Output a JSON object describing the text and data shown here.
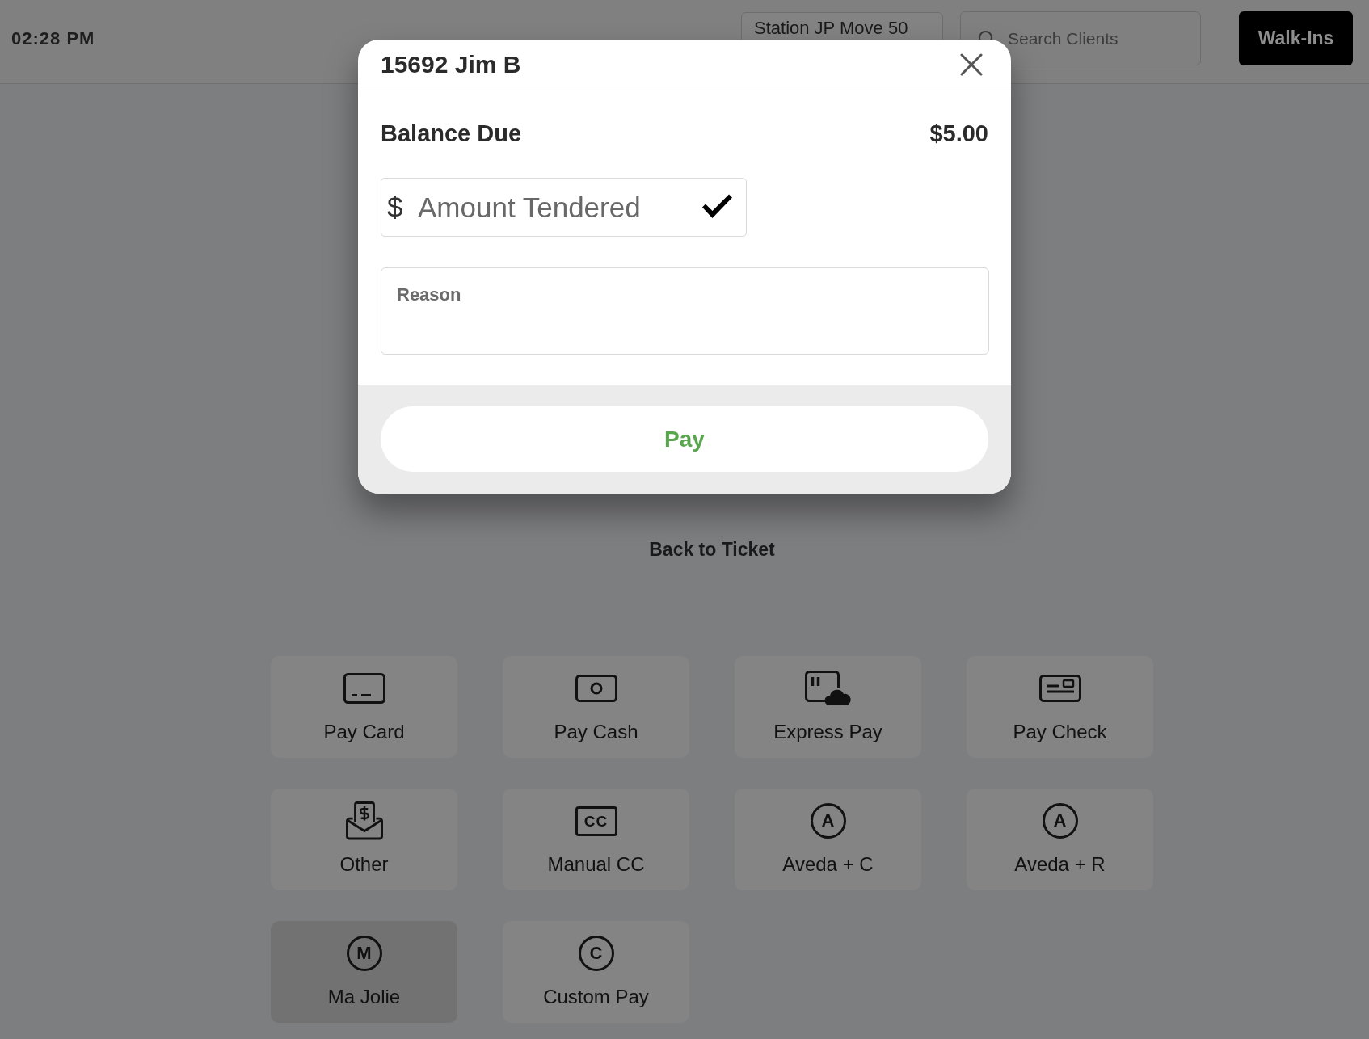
{
  "top_bar": {
    "time": "02:28 PM",
    "station_selector": "Station JP Move 50",
    "search": {
      "placeholder": "Search Clients"
    },
    "walk_ins_button": "Walk-Ins"
  },
  "payment_dialog": {
    "title": "15692 Jim B",
    "balance_due": {
      "label": "Balance Due",
      "amount": "$5.00"
    },
    "amount_field": {
      "prefix": "$",
      "placeholder": "Amount Tendered"
    },
    "reason_field": {
      "placeholder": "Reason"
    },
    "pay_button": "Pay"
  },
  "back_to_ticket_link": "Back to Ticket",
  "payment_methods": [
    {
      "label": "Pay Card",
      "kind": "card",
      "selected": false
    },
    {
      "label": "Pay Cash",
      "kind": "cash",
      "selected": false
    },
    {
      "label": "Express Pay",
      "kind": "express",
      "selected": false
    },
    {
      "label": "Pay Check",
      "kind": "check",
      "selected": false
    },
    {
      "label": "Other",
      "kind": "other",
      "selected": false
    },
    {
      "label": "Manual CC",
      "kind": "boxed-text",
      "icon_text": "CC",
      "selected": false
    },
    {
      "label": "Aveda + C",
      "kind": "circled-text",
      "icon_text": "A",
      "selected": false
    },
    {
      "label": "Aveda + R",
      "kind": "circled-text",
      "icon_text": "A",
      "selected": false
    },
    {
      "label": "Ma Jolie",
      "kind": "circled-text",
      "icon_text": "M",
      "selected": true
    },
    {
      "label": "Custom Pay",
      "kind": "circled-text",
      "icon_text": "C",
      "selected": false
    }
  ]
}
